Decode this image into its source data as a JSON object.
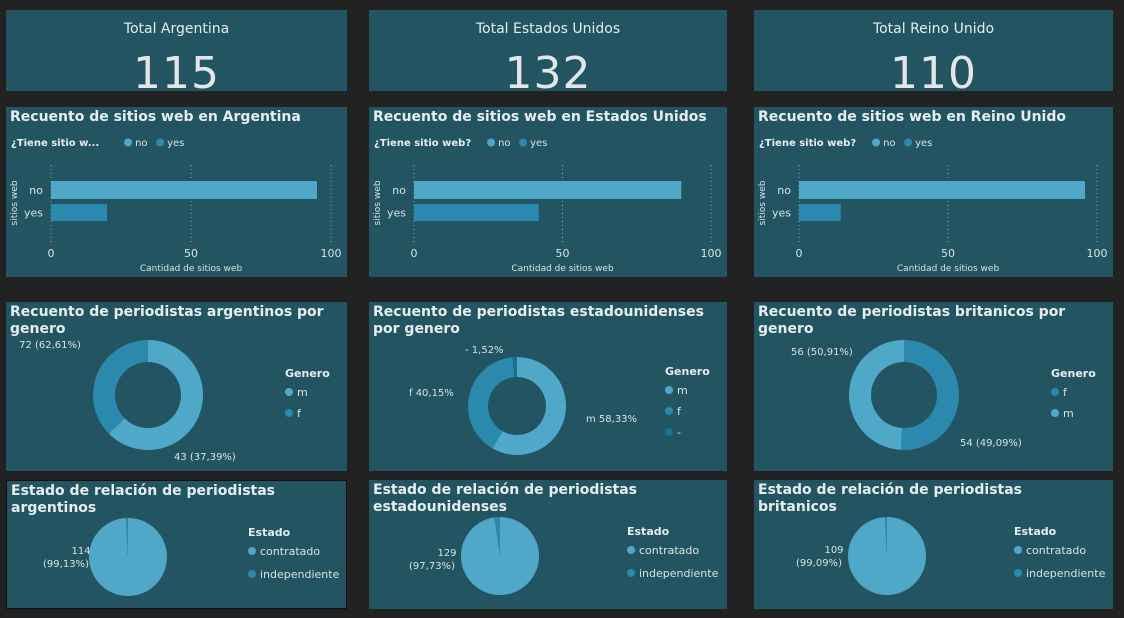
{
  "colors": {
    "background": "#222222",
    "tile": "#235462",
    "no": "#4fa8c8",
    "yes": "#2b89ad",
    "m": "#4fa8c8",
    "f": "#2b89ad",
    "dash": "#1d6f8c",
    "contratado": "#4fa8c8",
    "independiente": "#2b89ad"
  },
  "kpis": [
    {
      "title": "Total Argentina",
      "value": "115"
    },
    {
      "title": "Total Estados Unidos",
      "value": "132"
    },
    {
      "title": "Total Reino Unido",
      "value": "110"
    }
  ],
  "chart_data": [
    {
      "type": "bar",
      "orientation": "horizontal",
      "title": "Recuento de sitios web en Argentina",
      "legend_title": "¿Tiene sitio w...",
      "legend": [
        "no",
        "yes"
      ],
      "categories": [
        "no",
        "yes"
      ],
      "values": [
        95,
        20
      ],
      "xlabel": "Cantidad de sitios web",
      "ylabel": "sitios web",
      "xlim": [
        0,
        100
      ],
      "xticks": [
        "0",
        "50",
        "100"
      ]
    },
    {
      "type": "bar",
      "orientation": "horizontal",
      "title": "Recuento de sitios web en Estados Unidos",
      "legend_title": "¿Tiene sitio web?",
      "legend": [
        "no",
        "yes"
      ],
      "categories": [
        "no",
        "yes"
      ],
      "values": [
        90,
        42
      ],
      "xlabel": "Cantidad de sitios web",
      "ylabel": "sitios web",
      "xlim": [
        0,
        100
      ],
      "xticks": [
        "0",
        "50",
        "100"
      ]
    },
    {
      "type": "bar",
      "orientation": "horizontal",
      "title": "Recuento de sitios web en Reino Unido",
      "legend_title": "¿Tiene sitio web?",
      "legend": [
        "no",
        "yes"
      ],
      "categories": [
        "no",
        "yes"
      ],
      "values": [
        96,
        14
      ],
      "xlabel": "Cantidad de sitios web",
      "ylabel": "sitios web",
      "xlim": [
        0,
        100
      ],
      "xticks": [
        "0",
        "50",
        "100"
      ]
    },
    {
      "type": "pie",
      "donut": true,
      "title": "Recuento de periodistas argentinos por genero",
      "legend_title": "Genero",
      "legend": [
        "m",
        "f"
      ],
      "slices": [
        {
          "label": "m",
          "value": 72,
          "text": "72 (62,61%)"
        },
        {
          "label": "f",
          "value": 43,
          "text": "43 (37,39%)"
        }
      ]
    },
    {
      "type": "pie",
      "donut": true,
      "title": "Recuento de periodistas estadounidenses por genero",
      "legend_title": "Genero",
      "legend": [
        "m",
        "f",
        "-"
      ],
      "slices": [
        {
          "label": "m",
          "value": 77,
          "text": "m 58,33%"
        },
        {
          "label": "f",
          "value": 53,
          "text": "f 40,15%"
        },
        {
          "label": "-",
          "value": 2,
          "text": "- 1,52%"
        }
      ]
    },
    {
      "type": "pie",
      "donut": true,
      "title": "Recuento de periodistas britanicos por genero",
      "legend_title": "Genero",
      "legend": [
        "f",
        "m"
      ],
      "slices": [
        {
          "label": "f",
          "value": 56,
          "text": "56 (50,91%)"
        },
        {
          "label": "m",
          "value": 54,
          "text": "54 (49,09%)"
        }
      ]
    },
    {
      "type": "pie",
      "title": "Estado de relación de periodistas argentinos",
      "legend_title": "Estado",
      "legend": [
        "contratado",
        "independiente"
      ],
      "slices": [
        {
          "label": "contratado",
          "value": 114,
          "text": "114",
          "pct": "(99,13%)"
        },
        {
          "label": "independiente",
          "value": 1
        }
      ]
    },
    {
      "type": "pie",
      "title": "Estado de relación de periodistas estadounidenses",
      "legend_title": "Estado",
      "legend": [
        "contratado",
        "independiente"
      ],
      "slices": [
        {
          "label": "contratado",
          "value": 129,
          "text": "129",
          "pct": "(97,73%)"
        },
        {
          "label": "independiente",
          "value": 3
        }
      ]
    },
    {
      "type": "pie",
      "title": "Estado de relación de periodistas britanicos",
      "legend_title": "Estado",
      "legend": [
        "contratado",
        "independiente"
      ],
      "slices": [
        {
          "label": "contratado",
          "value": 109,
          "text": "109",
          "pct": "(99,09%)"
        },
        {
          "label": "independiente",
          "value": 1
        }
      ]
    }
  ]
}
